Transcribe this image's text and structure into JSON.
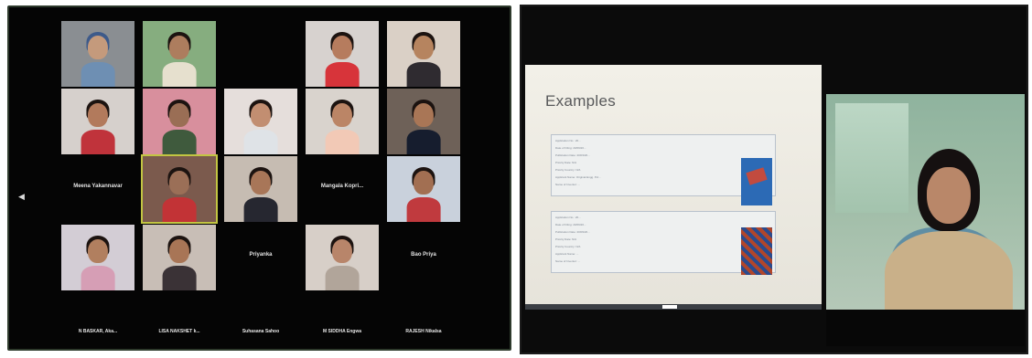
{
  "gallery": {
    "participants": [
      {
        "row": 0,
        "col": 0,
        "bg": "#8a8e92",
        "skin": "#c49a7c",
        "cloth": "#6e8fb3",
        "hair": "#3d5a8a",
        "name": ""
      },
      {
        "row": 0,
        "col": 1,
        "bg": "#86ad7f",
        "skin": "#ad7d5e",
        "cloth": "#e6e0ce",
        "hair": "#1c1310",
        "name": ""
      },
      {
        "row": 0,
        "col": 2,
        "bg": "#050505",
        "name": "",
        "video_off": true
      },
      {
        "row": 0,
        "col": 3,
        "bg": "#d7d2cf",
        "skin": "#b67c5e",
        "cloth": "#d7343a",
        "hair": "#1c1310",
        "name": ""
      },
      {
        "row": 0,
        "col": 4,
        "bg": "#dad0c6",
        "skin": "#b6845f",
        "cloth": "#2f2b30",
        "hair": "#1c1310",
        "name": ""
      },
      {
        "row": 1,
        "col": 0,
        "bg": "#d6d0cc",
        "skin": "#b27a5c",
        "cloth": "#c0333b",
        "hair": "#1c1310",
        "name": ""
      },
      {
        "row": 1,
        "col": 1,
        "bg": "#d88f9d",
        "skin": "#9a6e55",
        "cloth": "#3f5a3d",
        "hair": "#1c1310",
        "name": ""
      },
      {
        "row": 1,
        "col": 2,
        "bg": "#e5dedb",
        "skin": "#c28e71",
        "cloth": "#dfe3e7",
        "hair": "#1c1310",
        "name": ""
      },
      {
        "row": 1,
        "col": 3,
        "bg": "#d9d3cd",
        "skin": "#bb8566",
        "cloth": "#f2c9b6",
        "hair": "#1c1310",
        "name": ""
      },
      {
        "row": 1,
        "col": 4,
        "bg": "#6e6158",
        "skin": "#a97656",
        "cloth": "#161d2e",
        "hair": "#1c1310",
        "name": ""
      },
      {
        "row": 2,
        "col": 0,
        "bg": "#050505",
        "name": "Meena Yakannavar",
        "video_off": true
      },
      {
        "row": 2,
        "col": 1,
        "bg": "#7b5a4d",
        "skin": "#9b6f57",
        "cloth": "#c23336",
        "hair": "#1c1310",
        "name": "",
        "active": true
      },
      {
        "row": 2,
        "col": 2,
        "bg": "#c6bcb2",
        "skin": "#a87658",
        "cloth": "#262730",
        "hair": "#1c1310",
        "name": ""
      },
      {
        "row": 2,
        "col": 3,
        "bg": "#050505",
        "name": "Mangala Kopri...",
        "video_off": true
      },
      {
        "row": 2,
        "col": 4,
        "bg": "#c9d1dc",
        "skin": "#a26f52",
        "cloth": "#c03a3e",
        "hair": "#1c1310",
        "name": ""
      },
      {
        "row": 3,
        "col": 0,
        "bg": "#d3cdd5",
        "skin": "#b17f5f",
        "cloth": "#d69eb5",
        "hair": "#1c1310",
        "name": ""
      },
      {
        "row": 3,
        "col": 1,
        "bg": "#c8beb6",
        "skin": "#a87556",
        "cloth": "#3a3236",
        "hair": "#1c1310",
        "name": ""
      },
      {
        "row": 3,
        "col": 2,
        "bg": "#050505",
        "name": "Priyanka",
        "video_off": true
      },
      {
        "row": 3,
        "col": 3,
        "bg": "#d7cfc8",
        "skin": "#b8856a",
        "cloth": "#b1a59a",
        "hair": "#1c1310",
        "name": ""
      },
      {
        "row": 3,
        "col": 4,
        "bg": "#050505",
        "name": "Bao Priya",
        "video_off": true
      }
    ],
    "bottom_names": [
      "N BASKAR, Aka...",
      "LISA NAKSHET k...",
      "Suhasana Sahoo",
      "M SIDDHA Engwa",
      "RAJESH Nikalsa"
    ],
    "nav_arrow": "◀"
  },
  "share_screen": {
    "slide_title": "Examples",
    "entries": [
      {
        "lines": [
          "Application No.: 20...",
          "Date of Filing: 20/09/20...",
          "Publication Date: 20/03/20...",
          "Priority Date: N/A",
          "Priority Country: N/A",
          "Applicant Name: Originat Engg. Pvt...",
          "Name of Inventor: ..."
        ]
      },
      {
        "lines": [
          "Application No.: 20...",
          "Date of Filing: 20/09/20...",
          "Publication Date: 20/09/20...",
          "Priority Date: N/A",
          "Priority Country: N/A",
          "Applicant Name: ...",
          "Name of Inventor: ..."
        ]
      }
    ],
    "colors": {
      "slide_bg": "#efede5",
      "border": "#b9c2cc"
    }
  }
}
